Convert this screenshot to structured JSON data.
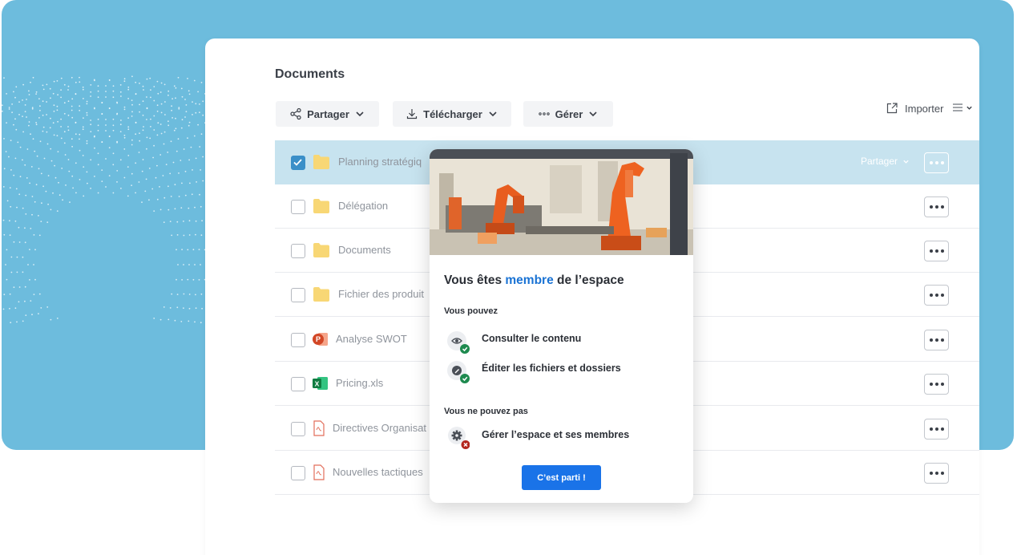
{
  "page": {
    "title": "Documents"
  },
  "toolbar": {
    "share_label": "Partager",
    "download_label": "Télécharger",
    "manage_label": "Gérer",
    "import_label": "Importer"
  },
  "files": [
    {
      "name": "Planning stratégiq",
      "type": "folder",
      "selected": true,
      "share_label": "Partager"
    },
    {
      "name": "Délégation",
      "type": "folder",
      "selected": false
    },
    {
      "name": "Documents",
      "type": "folder",
      "selected": false
    },
    {
      "name": "Fichier des produit",
      "type": "folder",
      "selected": false
    },
    {
      "name": "Analyse SWOT",
      "type": "powerpoint",
      "selected": false
    },
    {
      "name": "Pricing.xls",
      "type": "excel",
      "selected": false
    },
    {
      "name": "Directives Organisat",
      "type": "pdf",
      "selected": false
    },
    {
      "name": "Nouvelles tactiques",
      "type": "pdf",
      "selected": false
    }
  ],
  "modal": {
    "title_before": "Vous êtes ",
    "title_highlight": "membre",
    "title_after": " de l’espace",
    "can_heading": "Vous pouvez",
    "can": [
      {
        "label": "Consulter le contenu",
        "icon": "eye-icon"
      },
      {
        "label": "Éditer les fichiers et dossiers",
        "icon": "pencil-icon"
      }
    ],
    "cannot_heading": "Vous ne pouvez pas",
    "cannot": [
      {
        "label": "Gérer l’espace et ses membres",
        "icon": "gear-icon"
      }
    ],
    "cta_label": "C’est parti !"
  },
  "colors": {
    "background_panel": "#6dbcdd",
    "selected_row": "#c7e3ef",
    "accent": "#1a73e8",
    "allowed": "#1e8a4f",
    "denied": "#b3261e"
  }
}
